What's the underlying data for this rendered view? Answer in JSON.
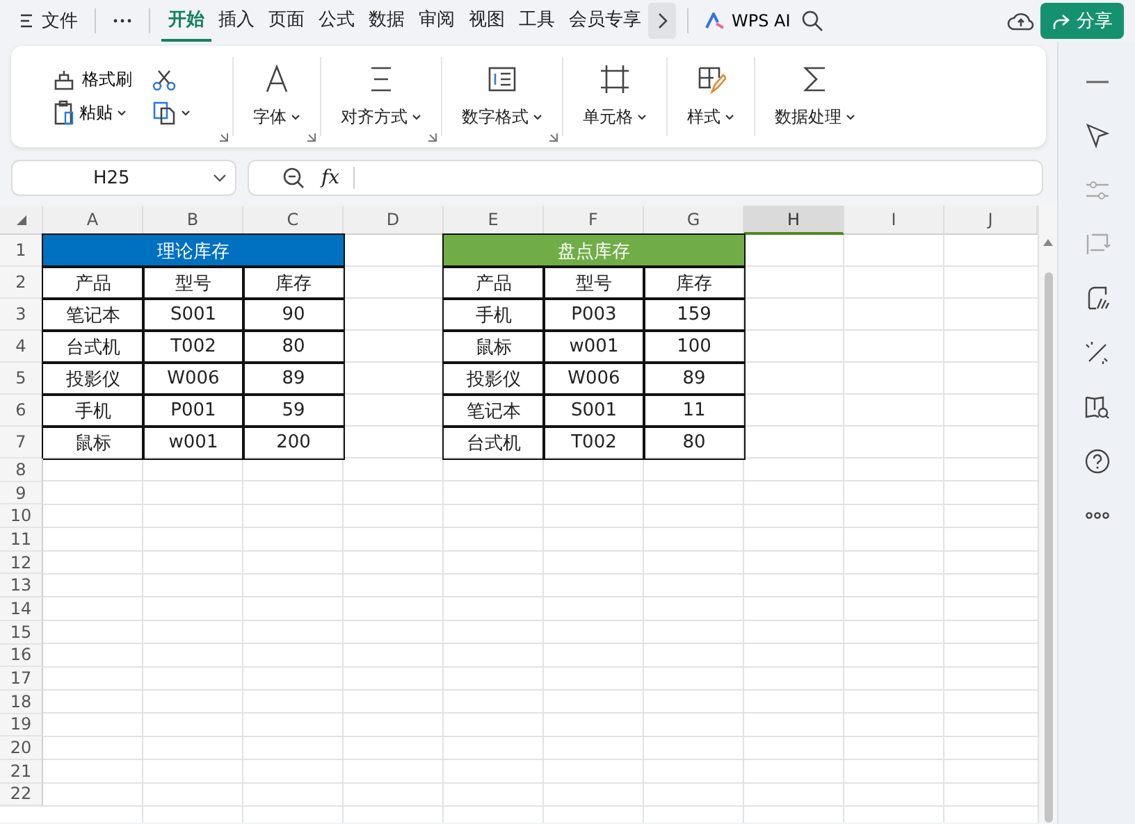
{
  "menu": {
    "file_label": "文件",
    "tabs": [
      {
        "label": "开始",
        "selected": true
      },
      {
        "label": "插入",
        "selected": false
      },
      {
        "label": "页面",
        "selected": false
      },
      {
        "label": "公式",
        "selected": false
      },
      {
        "label": "数据",
        "selected": false
      },
      {
        "label": "审阅",
        "selected": false
      },
      {
        "label": "视图",
        "selected": false
      },
      {
        "label": "工具",
        "selected": false
      },
      {
        "label": "会员专享",
        "selected": false
      }
    ],
    "ai_label": "WPS AI",
    "share_label": "分享"
  },
  "ribbon": {
    "groups": [
      {
        "kind": "clipboard",
        "labels": [
          "格式刷",
          "粘贴"
        ],
        "launcher": true
      },
      {
        "kind": "font",
        "label": "字体",
        "launcher": true
      },
      {
        "kind": "align",
        "label": "对齐方式",
        "launcher": true
      },
      {
        "kind": "number",
        "label": "数字格式",
        "launcher": true
      },
      {
        "kind": "cell",
        "label": "单元格",
        "launcher": false
      },
      {
        "kind": "style",
        "label": "样式",
        "launcher": false
      },
      {
        "kind": "sum",
        "label": "数据处理",
        "launcher": false
      }
    ]
  },
  "formula_bar": {
    "name_box": "H25",
    "function_label": "fx"
  },
  "sheet": {
    "columns": [
      {
        "label": "A",
        "selected": false
      },
      {
        "label": "B",
        "selected": false
      },
      {
        "label": "C",
        "selected": false
      },
      {
        "label": "D",
        "selected": false
      },
      {
        "label": "E",
        "selected": false
      },
      {
        "label": "F",
        "selected": false
      },
      {
        "label": "G",
        "selected": false
      },
      {
        "label": "H",
        "selected": true
      },
      {
        "label": "I",
        "selected": false
      },
      {
        "label": "J",
        "selected": false
      }
    ],
    "row_numbers": [
      "1",
      "2",
      "3",
      "4",
      "5",
      "6",
      "7",
      "8",
      "9",
      "10",
      "11",
      "12",
      "13",
      "14",
      "15",
      "16",
      "17",
      "18",
      "19",
      "20",
      "21",
      "22"
    ],
    "tables": [
      {
        "title": "理论库存",
        "color": "#0070c0",
        "headers": [
          "产品",
          "型号",
          "库存"
        ],
        "rows": [
          [
            "笔记本",
            "S001",
            "90"
          ],
          [
            "台式机",
            "T002",
            "80"
          ],
          [
            "投影仪",
            "W006",
            "89"
          ],
          [
            "手机",
            "P001",
            "59"
          ],
          [
            "鼠标",
            "w001",
            "200"
          ]
        ]
      },
      {
        "title": "盘点库存",
        "color": "#70ad47",
        "headers": [
          "产品",
          "型号",
          "库存"
        ],
        "rows": [
          [
            "手机",
            "P003",
            "159"
          ],
          [
            "鼠标",
            "w001",
            "100"
          ],
          [
            "投影仪",
            "W006",
            "89"
          ],
          [
            "笔记本",
            "S001",
            "11"
          ],
          [
            "台式机",
            "T002",
            "80"
          ]
        ]
      }
    ]
  }
}
